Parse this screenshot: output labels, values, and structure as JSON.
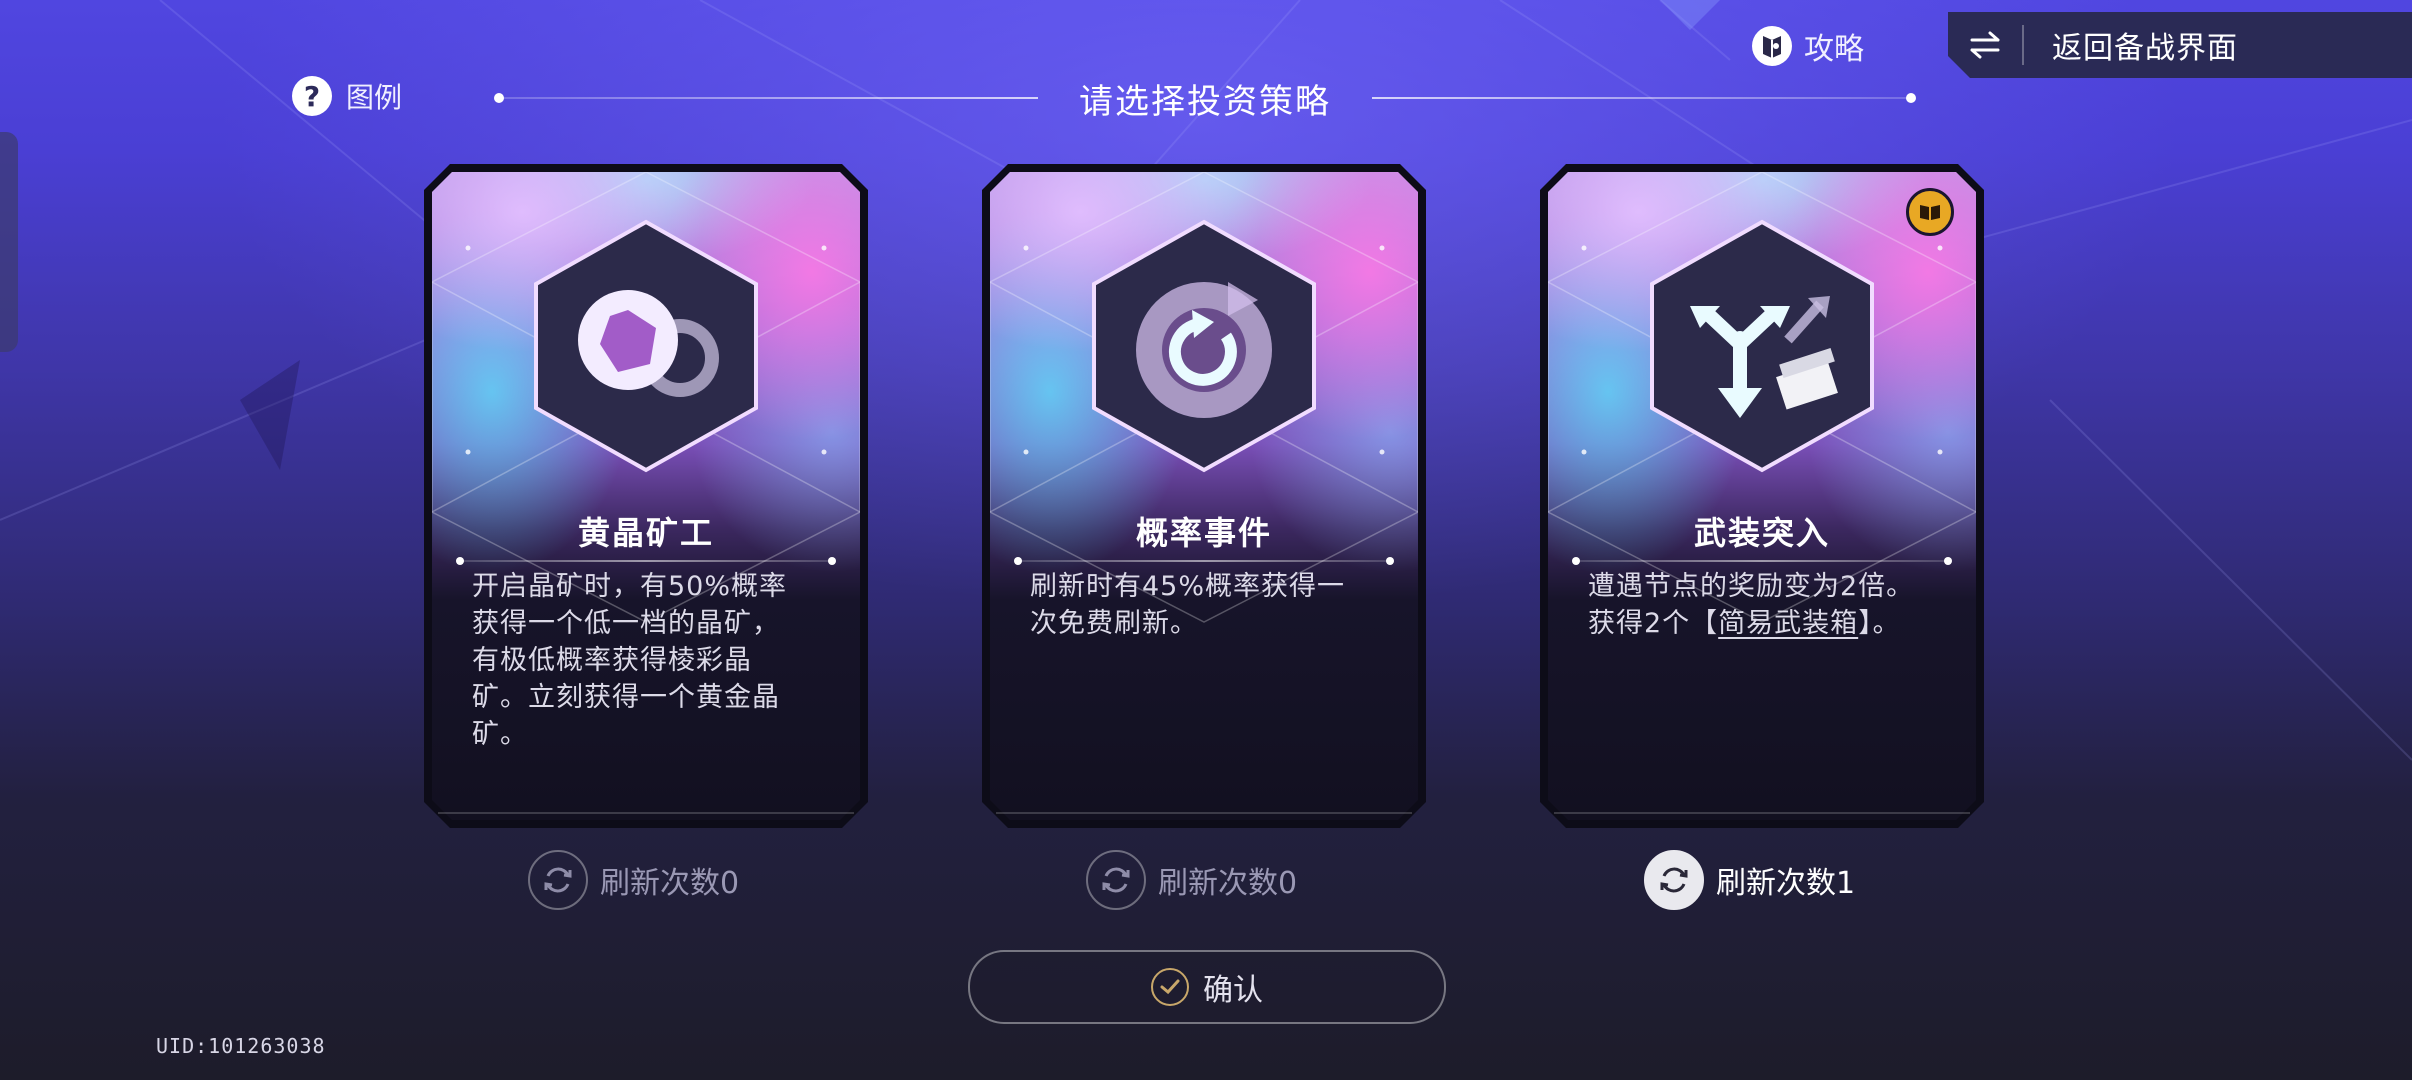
{
  "header": {
    "legend_label": "图例",
    "title": "请选择投资策略",
    "guide_label": "攻略",
    "back_label": "返回备战界面"
  },
  "cards": [
    {
      "name": "黄晶矿工",
      "icon": "ore-ring-icon",
      "description_lines": [
        "开启晶矿时，有50%概率",
        "获得一个低一档的晶矿，",
        "有极低概率获得棱彩晶",
        "矿。立刻获得一个黄金晶",
        "矿。"
      ],
      "refresh_label": "刷新次数0",
      "refresh_active": false
    },
    {
      "name": "概率事件",
      "icon": "refresh-cycle-icon",
      "description_lines": [
        "刷新时有45%概率获得一",
        "次免费刷新。"
      ],
      "refresh_label": "刷新次数0",
      "refresh_active": false
    },
    {
      "name": "武装突入",
      "icon": "branch-arrows-box-icon",
      "description_line1": "遭遇节点的奖励变为2倍。",
      "description_line2_prefix": "获得2个【",
      "description_line2_link": "简易武装箱",
      "description_line2_suffix": "】。",
      "badge_icon": "book-icon",
      "refresh_label": "刷新次数1",
      "refresh_active": true
    }
  ],
  "confirm_label": "确认",
  "uid": "UID:101263038",
  "colors": {
    "bg_top": "#5046e0",
    "bg_bottom": "#1d1c2a",
    "badge": "#e8a824",
    "confirm_check": "#c8a76a"
  }
}
